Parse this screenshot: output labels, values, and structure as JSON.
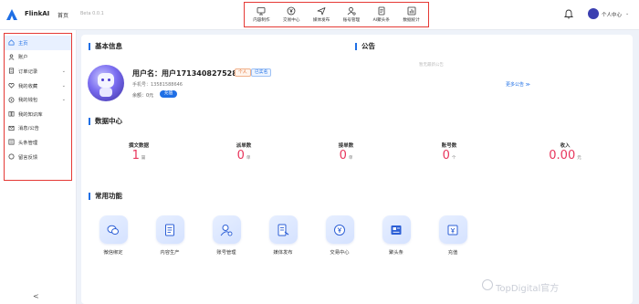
{
  "app": {
    "name": "FlinkAI",
    "home": "首页",
    "version": "Beta 0.0.1",
    "accent": "#1f6fe5",
    "highlight_red": "#e53935"
  },
  "topnav": [
    {
      "label": "内容制作",
      "icon": "monitor-icon"
    },
    {
      "label": "交易中心",
      "icon": "yuan-circle-icon"
    },
    {
      "label": "媒体发布",
      "icon": "send-icon"
    },
    {
      "label": "账号管理",
      "icon": "user-settings-icon"
    },
    {
      "label": "AI聚头条",
      "icon": "document-icon"
    },
    {
      "label": "数据统计",
      "icon": "chart-icon"
    }
  ],
  "user_menu": {
    "name": "个人中心",
    "chevron": "⌄"
  },
  "sidebar": {
    "items": [
      {
        "label": "主页",
        "icon": "home-icon",
        "active": true,
        "has_chevron": false
      },
      {
        "label": "账户",
        "icon": "user-icon",
        "active": false,
        "has_chevron": false
      },
      {
        "label": "订单记录",
        "icon": "order-icon",
        "active": false,
        "has_chevron": true
      },
      {
        "label": "我的收藏",
        "icon": "heart-icon",
        "active": false,
        "has_chevron": true
      },
      {
        "label": "我的钱包",
        "icon": "wallet-icon",
        "active": false,
        "has_chevron": true
      },
      {
        "label": "我的知识库",
        "icon": "knowledge-icon",
        "active": false,
        "has_chevron": false
      },
      {
        "label": "消息/公告",
        "icon": "message-icon",
        "active": false,
        "has_chevron": false
      },
      {
        "label": "头条管理",
        "icon": "news-icon",
        "active": false,
        "has_chevron": false
      },
      {
        "label": "留言反馈",
        "icon": "feedback-icon",
        "active": false,
        "has_chevron": false
      }
    ],
    "collapse": "<"
  },
  "basic_info": {
    "title": "基本信息",
    "username": "用户名：用户1713408275283",
    "tag_personal": "个人",
    "tag_verified": "已实名",
    "phone": "手机号：13581588646",
    "balance": "余额：0元",
    "recharge": "充值"
  },
  "notice": {
    "title": "公告",
    "empty": "暂无最新公告",
    "more": "更多公告 ≫"
  },
  "data_center": {
    "title": "数据中心",
    "stats": [
      {
        "label": "撰文数据",
        "value": "1",
        "unit": "篇"
      },
      {
        "label": "派单数",
        "value": "0",
        "unit": "单"
      },
      {
        "label": "接单数",
        "value": "0",
        "unit": "单"
      },
      {
        "label": "账号数",
        "value": "0",
        "unit": "个"
      },
      {
        "label": "收入",
        "value": "0.00",
        "unit": "元"
      }
    ]
  },
  "functions": {
    "title": "常用功能",
    "items": [
      {
        "label": "微信绑定",
        "icon": "wechat-icon"
      },
      {
        "label": "内容生产",
        "icon": "content-icon"
      },
      {
        "label": "账号管理",
        "icon": "account-manage-icon"
      },
      {
        "label": "媒体发布",
        "icon": "media-publish-icon"
      },
      {
        "label": "交易中心",
        "icon": "trade-icon"
      },
      {
        "label": "聚头条",
        "icon": "news-aggregate-icon"
      },
      {
        "label": "充值",
        "icon": "recharge-icon"
      }
    ]
  },
  "watermark": "TopDigital官方"
}
